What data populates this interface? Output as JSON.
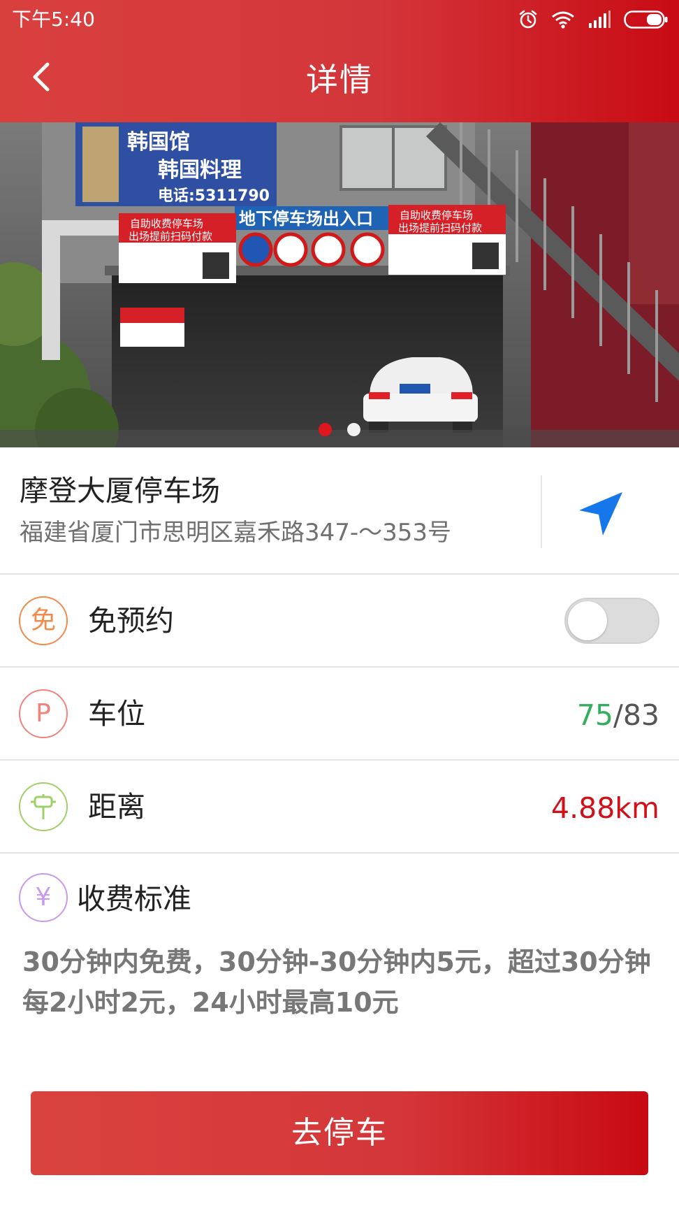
{
  "status_bar": {
    "time": "下午5:40",
    "icons": [
      "alarm-icon",
      "wifi-icon",
      "signal-icon",
      "battery-icon"
    ]
  },
  "header": {
    "title": "详情",
    "back_icon": "chevron-left-icon"
  },
  "banner": {
    "photo_signs": {
      "restaurant_name": "韩国馆",
      "restaurant_food": "韩国料理",
      "restaurant_phone": "电话:5311790",
      "entrance": "地下停车场出入口",
      "notice_title": "自助收费停车场",
      "notice_subtitle": "出场提前扫码付款"
    },
    "slide_count": 2,
    "active_slide": 1
  },
  "parking_lot": {
    "name": "摩登大厦停车场",
    "address": "福建省厦门市思明区嘉禾路347-～353号",
    "navigate_icon": "navigation-arrow-icon"
  },
  "rows": {
    "reservation": {
      "icon_char": "免",
      "label": "免预约",
      "toggle_on": false
    },
    "spaces": {
      "icon_char": "P",
      "label": "车位",
      "available": "75",
      "separator": "/",
      "total": "83"
    },
    "distance": {
      "label": "距离",
      "value": "4.88km"
    },
    "fee": {
      "icon_char": "¥",
      "label": "收费标准",
      "text": "30分钟内免费，30分钟-30分钟内5元，超过30分钟每2小时2元，24小时最高10元"
    }
  },
  "action": {
    "go_label": "去停车"
  },
  "colors": {
    "brand_red": "#d3363a",
    "available_green": "#35ad5e",
    "distance_red": "#d0111a",
    "navigate_blue": "#1677ea",
    "icon_orange": "#f28a4c",
    "icon_pink": "#f1827c",
    "icon_green": "#9fd06a",
    "icon_purple": "#c79af0"
  }
}
